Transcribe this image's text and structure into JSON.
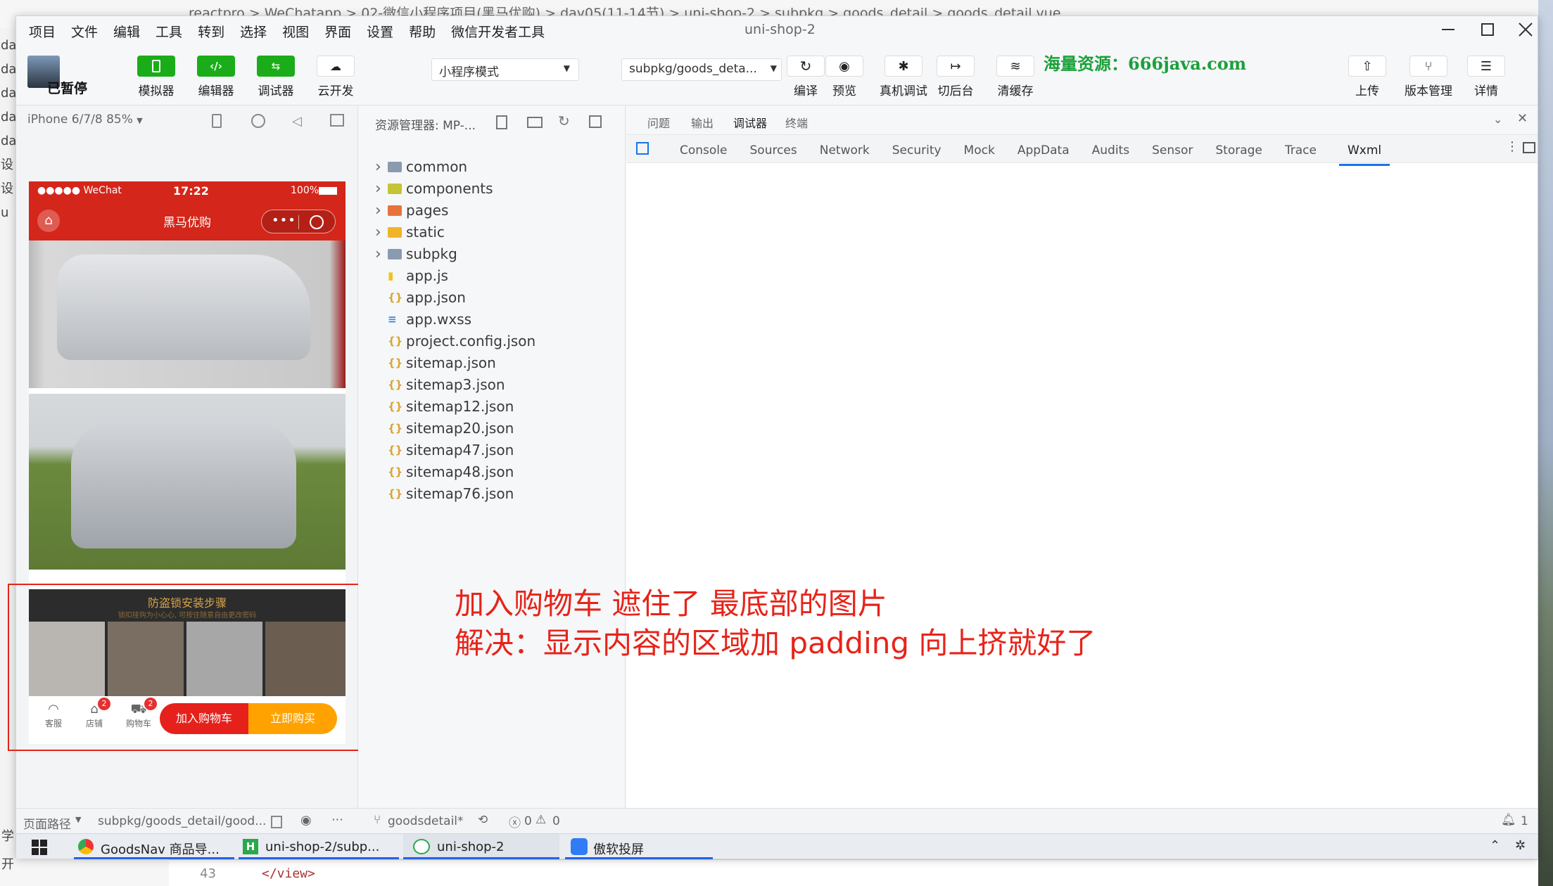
{
  "bg_editor": {
    "breadcrumb": "reactpro > WeChatapp > 02-微信小程序项目(黑马优购) > day05(11-14节) > uni-shop-2 > subpkg > goods_detail > goods_detail.vue",
    "left_labels": [
      "da",
      "da",
      "da",
      "da",
      "da",
      "设",
      "设",
      "u"
    ],
    "line_number": "43",
    "code_line": "</view>",
    "left_bottom": [
      "学",
      "开"
    ]
  },
  "window": {
    "title": "uni-shop-2",
    "menu": [
      "项目",
      "文件",
      "编辑",
      "工具",
      "转到",
      "选择",
      "视图",
      "界面",
      "设置",
      "帮助",
      "微信开发者工具"
    ],
    "avatar_label": "已暂停"
  },
  "toolbar": {
    "simulator": "模拟器",
    "editor": "编辑器",
    "debugger": "调试器",
    "cloud": "云开发",
    "mode": "小程序模式",
    "page_path": "subpkg/goods_deta...",
    "compile": "编译",
    "preview": "预览",
    "real_debug": "真机调试",
    "background": "切后台",
    "clear_cache": "清缓存",
    "upload": "上传",
    "version": "版本管理",
    "details": "详情",
    "watermark": "海量资源：666java.com"
  },
  "simulator": {
    "device": "iPhone 6/7/8 85%",
    "status_left": "●●●●● WeChat",
    "time": "17:22",
    "battery": "100%",
    "nav_title": "黑马优购",
    "banner_title": "防盗锁安装步骤",
    "banner_sub": "锁扣挂钩为小心心, 可按住随意自由更改密码",
    "icons": [
      {
        "label": "客服",
        "badge": ""
      },
      {
        "label": "店铺",
        "badge": "2"
      },
      {
        "label": "购物车",
        "badge": "2"
      }
    ],
    "add_cart": "加入购物车",
    "buy_now": "立即购买"
  },
  "explorer": {
    "title": "资源管理器: MP-...",
    "items": [
      {
        "name": "common",
        "type": "folder",
        "color": "#8a9bb0"
      },
      {
        "name": "components",
        "type": "folder",
        "color": "#c4c437"
      },
      {
        "name": "pages",
        "type": "folder",
        "color": "#e8733a"
      },
      {
        "name": "static",
        "type": "folder",
        "color": "#f0b429"
      },
      {
        "name": "subpkg",
        "type": "folder",
        "color": "#8a9bb0"
      },
      {
        "name": "app.js",
        "type": "js",
        "color": "#f0c419"
      },
      {
        "name": "app.json",
        "type": "json",
        "color": "#d8a530"
      },
      {
        "name": "app.wxss",
        "type": "wxss",
        "color": "#2d8ae0"
      },
      {
        "name": "project.config.json",
        "type": "json",
        "color": "#d8a530"
      },
      {
        "name": "sitemap.json",
        "type": "json",
        "color": "#d8a530"
      },
      {
        "name": "sitemap3.json",
        "type": "json",
        "color": "#d8a530"
      },
      {
        "name": "sitemap12.json",
        "type": "json",
        "color": "#d8a530"
      },
      {
        "name": "sitemap20.json",
        "type": "json",
        "color": "#d8a530"
      },
      {
        "name": "sitemap47.json",
        "type": "json",
        "color": "#d8a530"
      },
      {
        "name": "sitemap48.json",
        "type": "json",
        "color": "#d8a530"
      },
      {
        "name": "sitemap76.json",
        "type": "json",
        "color": "#d8a530"
      }
    ]
  },
  "debugger": {
    "top_tabs": [
      "问题",
      "输出",
      "调试器",
      "终端"
    ],
    "active_top": "调试器",
    "tabs": [
      "Console",
      "Sources",
      "Network",
      "Security",
      "Mock",
      "AppData",
      "Audits",
      "Sensor",
      "Storage",
      "Trace",
      "Wxml"
    ],
    "active_tab": "Wxml"
  },
  "annotation": {
    "line1": "加入购物车 遮住了 最底部的图片",
    "line2": "解决：显示内容的区域加 padding 向上挤就好了",
    "color": "#e6241a"
  },
  "statusbar": {
    "page_route": "页面路径",
    "route": "subpkg/goods_detail/good...",
    "branch": "goodsdetail*",
    "errors": "0",
    "warnings": "0",
    "bell_count": "1"
  },
  "taskbar": {
    "items": [
      "GoodsNav 商品导...",
      "uni-shop-2/subp...",
      "uni-shop-2",
      "傲软投屏"
    ]
  }
}
